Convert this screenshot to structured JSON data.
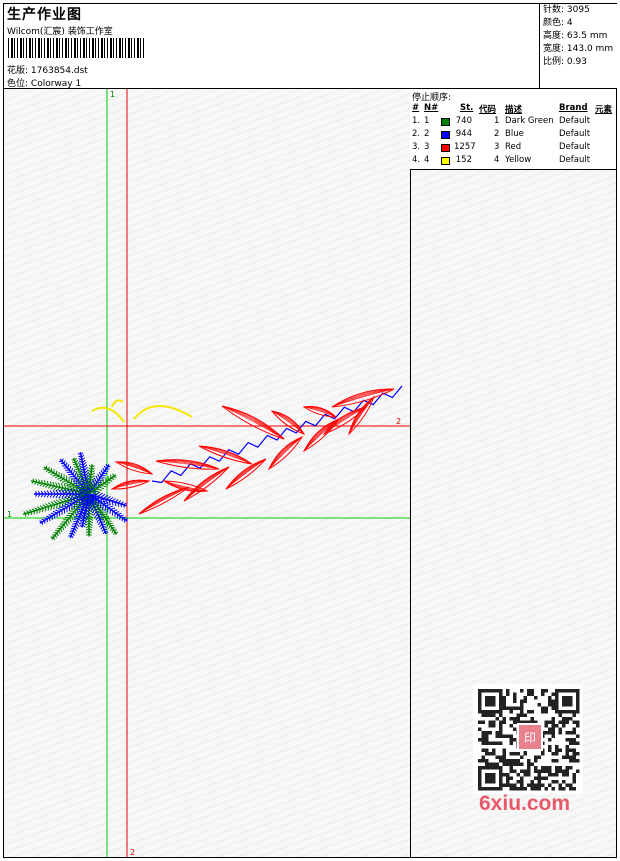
{
  "header": {
    "title": "生产作业图",
    "company": "Wilcom(汇宸) 装饰工作室",
    "file_label": "花版:",
    "file_name": "1763854.dst",
    "colorway_label": "色位:",
    "colorway": "Colorway 1"
  },
  "stats": {
    "stitches_label": "针数:",
    "stitches": "3095",
    "colors_label": "颜色:",
    "colors": "4",
    "height_label": "高度:",
    "height": "63.5 mm",
    "width_label": "宽度:",
    "width": "143.0 mm",
    "scale_label": "比例:",
    "scale": "0.93"
  },
  "legend": {
    "title": "停止顺序:",
    "headers": {
      "num": "#",
      "no": "N#",
      "st": "St.",
      "code": "代码",
      "desc": "描述",
      "brand": "Brand",
      "element": "元素"
    },
    "rows": [
      {
        "num": "1.",
        "no": "1",
        "color": "#008000",
        "st": "740",
        "code": "1",
        "desc": "Dark Green",
        "brand": "Default"
      },
      {
        "num": "2.",
        "no": "2",
        "color": "#0000ff",
        "st": "944",
        "code": "2",
        "desc": "Blue",
        "brand": "Default"
      },
      {
        "num": "3.",
        "no": "3",
        "color": "#ff0000",
        "st": "1257",
        "code": "3",
        "desc": "Red",
        "brand": "Default"
      },
      {
        "num": "4.",
        "no": "4",
        "color": "#ffff00",
        "st": "152",
        "code": "4",
        "desc": "Yellow",
        "brand": "Default"
      }
    ]
  },
  "design": {
    "guide_labels": {
      "green_top": "1",
      "green_left": "1",
      "red_right": "2",
      "red_bottom": "2"
    }
  },
  "watermark": {
    "text": "6xiu.com",
    "seal": "印"
  }
}
